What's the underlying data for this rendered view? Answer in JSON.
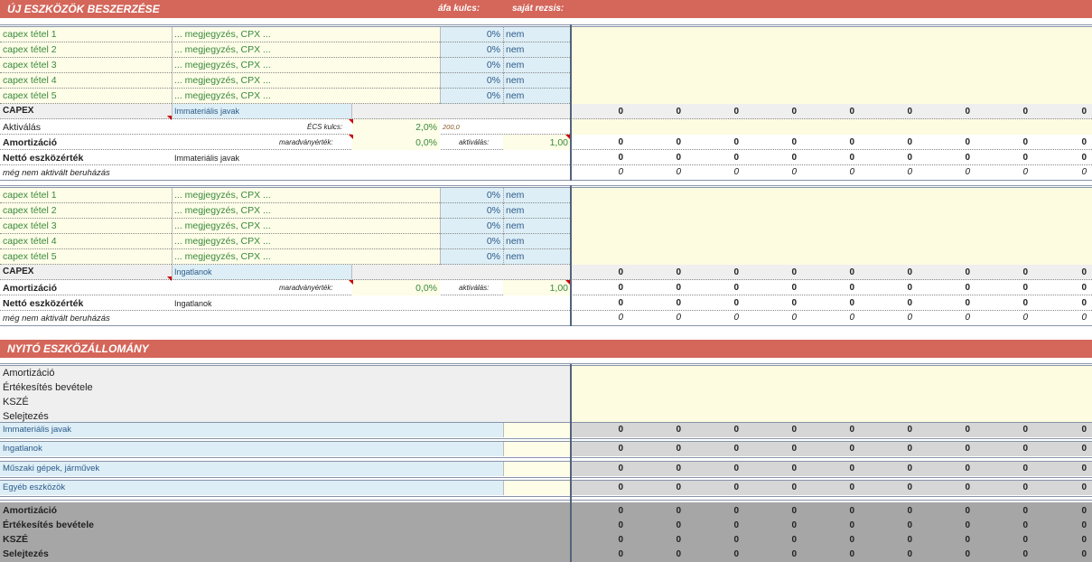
{
  "section1": {
    "title": "ÚJ ESZKÖZÖK BESZERZÉSE",
    "afa_label": "áfa kulcs:",
    "rezsi_label": "saját rezsis:"
  },
  "section2": {
    "title": "NYITÓ ESZKÖZÁLLOMÁNY"
  },
  "blocks": [
    {
      "items": [
        {
          "name": "capex tétel 1",
          "note": "... megjegyzés, CPX ...",
          "afa": "0%",
          "rezsi": "nem"
        },
        {
          "name": "capex tétel 2",
          "note": "... megjegyzés, CPX ...",
          "afa": "0%",
          "rezsi": "nem"
        },
        {
          "name": "capex tétel 3",
          "note": "... megjegyzés, CPX ...",
          "afa": "0%",
          "rezsi": "nem"
        },
        {
          "name": "capex tétel 4",
          "note": "... megjegyzés, CPX ...",
          "afa": "0%",
          "rezsi": "nem"
        },
        {
          "name": "capex tétel 5",
          "note": "... megjegyzés, CPX ...",
          "afa": "0%",
          "rezsi": "nem"
        }
      ],
      "capex_label": "CAPEX",
      "capex_category": "Immateriális javak",
      "aktivalas_label": "Aktiválás",
      "ecs_label": "ÉCS kulcs:",
      "ecs_value": "2,0%",
      "ecs_extra": "200,0",
      "amort_label": "Amortizáció",
      "marad_label": "maradványérték:",
      "marad_value": "0,0%",
      "aktiv_label": "aktiválás:",
      "aktiv_value": "1,00",
      "netto_label": "Nettó eszközérték",
      "netto_category": "Immateriális javak",
      "meg_label": "még nem aktivált beruházás"
    },
    {
      "items": [
        {
          "name": "capex tétel 1",
          "note": "... megjegyzés, CPX ...",
          "afa": "0%",
          "rezsi": "nem"
        },
        {
          "name": "capex tétel 2",
          "note": "... megjegyzés, CPX ...",
          "afa": "0%",
          "rezsi": "nem"
        },
        {
          "name": "capex tétel 3",
          "note": "... megjegyzés, CPX ...",
          "afa": "0%",
          "rezsi": "nem"
        },
        {
          "name": "capex tétel 4",
          "note": "... megjegyzés, CPX ...",
          "afa": "0%",
          "rezsi": "nem"
        },
        {
          "name": "capex tétel 5",
          "note": "... megjegyzés, CPX ...",
          "afa": "0%",
          "rezsi": "nem"
        }
      ],
      "capex_label": "CAPEX",
      "capex_category": "Ingatlanok",
      "amort_label": "Amortizáció",
      "marad_label": "maradványérték:",
      "marad_value": "0,0%",
      "aktiv_label": "aktiválás:",
      "aktiv_value": "1,00",
      "netto_label": "Nettó eszközérték",
      "netto_category": "Ingatlanok",
      "meg_label": "még nem aktivált beruházás"
    }
  ],
  "opening": {
    "labels": [
      "Amortizáció",
      "Értékesítés bevétele",
      "KSZÉ",
      "Selejtezés"
    ],
    "categories": [
      "Immateriális javak",
      "Ingatlanok",
      "Műszaki gépek, járművek",
      "Egyéb eszközök"
    ],
    "totals": [
      "Amortizáció",
      "Értékesítés bevétele",
      "KSZÉ",
      "Selejtezés"
    ]
  },
  "value": "0"
}
